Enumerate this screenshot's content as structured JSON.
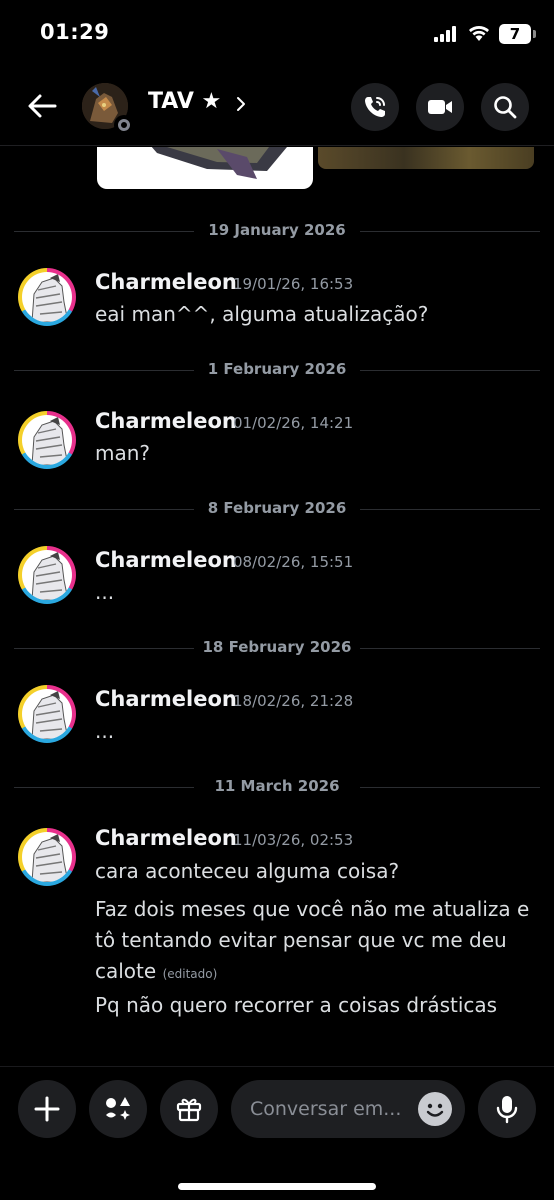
{
  "status_bar": {
    "time": "01:29",
    "battery": "7"
  },
  "header": {
    "channel_name": "TAV ★"
  },
  "dividers": [
    {
      "label": "19 January 2026"
    },
    {
      "label": "1 February 2026"
    },
    {
      "label": "8 February 2026"
    },
    {
      "label": "18 February 2026"
    },
    {
      "label": "11 March 2026"
    }
  ],
  "messages": [
    {
      "author": "Charmeleon",
      "time": "19/01/26, 16:53",
      "lines": [
        "eai man^^, alguma atualização?"
      ]
    },
    {
      "author": "Charmeleon",
      "time": "01/02/26, 14:21",
      "lines": [
        "man?"
      ]
    },
    {
      "author": "Charmeleon",
      "time": "08/02/26, 15:51",
      "lines": [
        "..."
      ]
    },
    {
      "author": "Charmeleon",
      "time": "18/02/26, 21:28",
      "lines": [
        "..."
      ]
    },
    {
      "author": "Charmeleon",
      "time": "11/03/26, 02:53",
      "lines": [
        "cara aconteceu alguma coisa?",
        "Faz dois meses que você não me atualiza e",
        "tô tentando evitar pensar que vc me deu",
        "calote",
        "Pq não quero recorrer a coisas drásticas"
      ],
      "edited": "(editado)"
    }
  ],
  "composer": {
    "placeholder": "Conversar em..."
  },
  "colors": {
    "background": "#000000",
    "text_muted": "#949ba4",
    "button_bg": "#1e1f22"
  }
}
